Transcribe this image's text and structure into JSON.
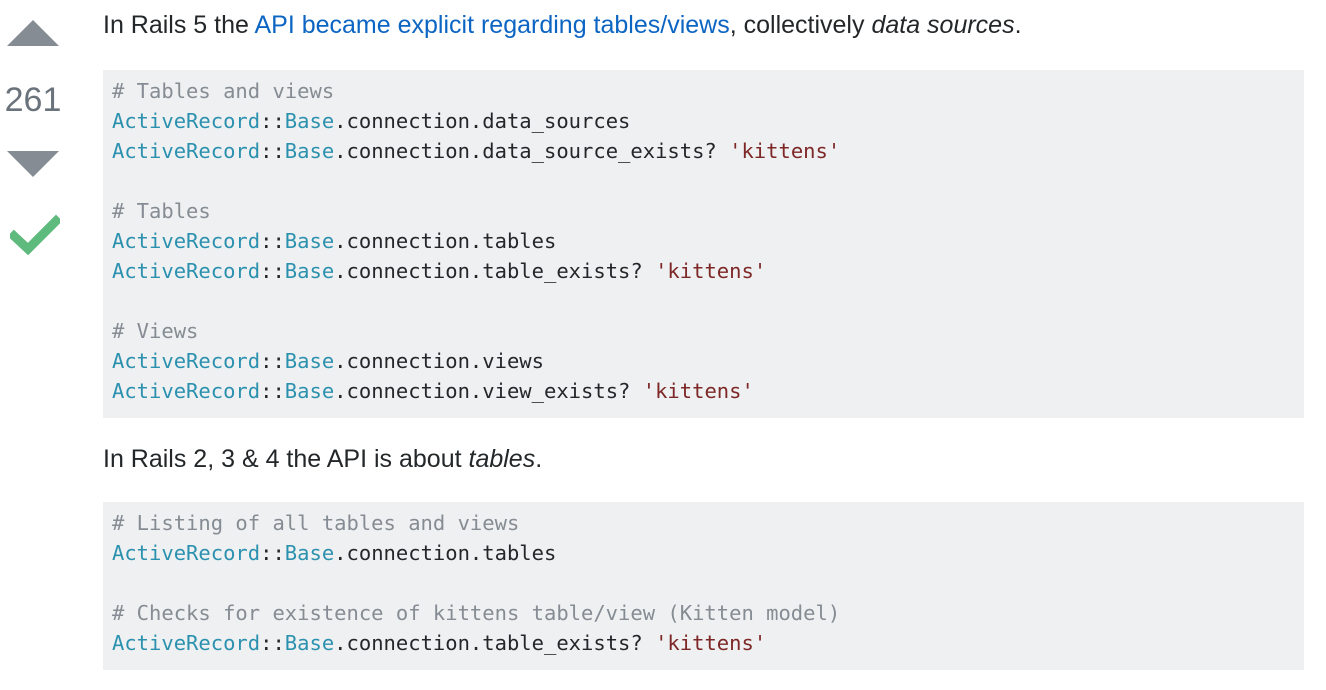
{
  "vote": {
    "count": "261",
    "up_label": "vote up",
    "down_label": "vote down",
    "accepted_label": "accepted answer"
  },
  "para1": {
    "before": "In Rails 5 the ",
    "link": "API became explicit regarding tables/views",
    "middle": ", collectively ",
    "em": "data sources",
    "after": "."
  },
  "code1": [
    [
      {
        "t": "com",
        "v": "# Tables and views"
      }
    ],
    [
      {
        "t": "cls",
        "v": "ActiveRecord"
      },
      {
        "t": "txt",
        "v": "::"
      },
      {
        "t": "cls",
        "v": "Base"
      },
      {
        "t": "txt",
        "v": ".connection.data_sources"
      }
    ],
    [
      {
        "t": "cls",
        "v": "ActiveRecord"
      },
      {
        "t": "txt",
        "v": "::"
      },
      {
        "t": "cls",
        "v": "Base"
      },
      {
        "t": "txt",
        "v": ".connection.data_source_exists? "
      },
      {
        "t": "str",
        "v": "'kittens'"
      }
    ],
    [],
    [
      {
        "t": "com",
        "v": "# Tables"
      }
    ],
    [
      {
        "t": "cls",
        "v": "ActiveRecord"
      },
      {
        "t": "txt",
        "v": "::"
      },
      {
        "t": "cls",
        "v": "Base"
      },
      {
        "t": "txt",
        "v": ".connection.tables"
      }
    ],
    [
      {
        "t": "cls",
        "v": "ActiveRecord"
      },
      {
        "t": "txt",
        "v": "::"
      },
      {
        "t": "cls",
        "v": "Base"
      },
      {
        "t": "txt",
        "v": ".connection.table_exists? "
      },
      {
        "t": "str",
        "v": "'kittens'"
      }
    ],
    [],
    [
      {
        "t": "com",
        "v": "# Views"
      }
    ],
    [
      {
        "t": "cls",
        "v": "ActiveRecord"
      },
      {
        "t": "txt",
        "v": "::"
      },
      {
        "t": "cls",
        "v": "Base"
      },
      {
        "t": "txt",
        "v": ".connection.views"
      }
    ],
    [
      {
        "t": "cls",
        "v": "ActiveRecord"
      },
      {
        "t": "txt",
        "v": "::"
      },
      {
        "t": "cls",
        "v": "Base"
      },
      {
        "t": "txt",
        "v": ".connection.view_exists? "
      },
      {
        "t": "str",
        "v": "'kittens'"
      }
    ]
  ],
  "para2": {
    "before": "In Rails 2, 3 & 4 the API is about ",
    "em": "tables",
    "after": "."
  },
  "code2": [
    [
      {
        "t": "com",
        "v": "# Listing of all tables and views"
      }
    ],
    [
      {
        "t": "cls",
        "v": "ActiveRecord"
      },
      {
        "t": "txt",
        "v": "::"
      },
      {
        "t": "cls",
        "v": "Base"
      },
      {
        "t": "txt",
        "v": ".connection.tables"
      }
    ],
    [],
    [
      {
        "t": "com",
        "v": "# Checks for existence of kittens table/view (Kitten model)"
      }
    ],
    [
      {
        "t": "cls",
        "v": "ActiveRecord"
      },
      {
        "t": "txt",
        "v": "::"
      },
      {
        "t": "cls",
        "v": "Base"
      },
      {
        "t": "txt",
        "v": ".connection.table_exists? "
      },
      {
        "t": "str",
        "v": "'kittens'"
      }
    ]
  ],
  "colors": {
    "link": "#0c65c2",
    "vote_arrow": "#858c93",
    "accepted_check": "#5eba7d",
    "code_bg": "#eff0f1",
    "code_class": "#2b91af",
    "code_string": "#7d2727",
    "code_comment": "#858c93"
  }
}
